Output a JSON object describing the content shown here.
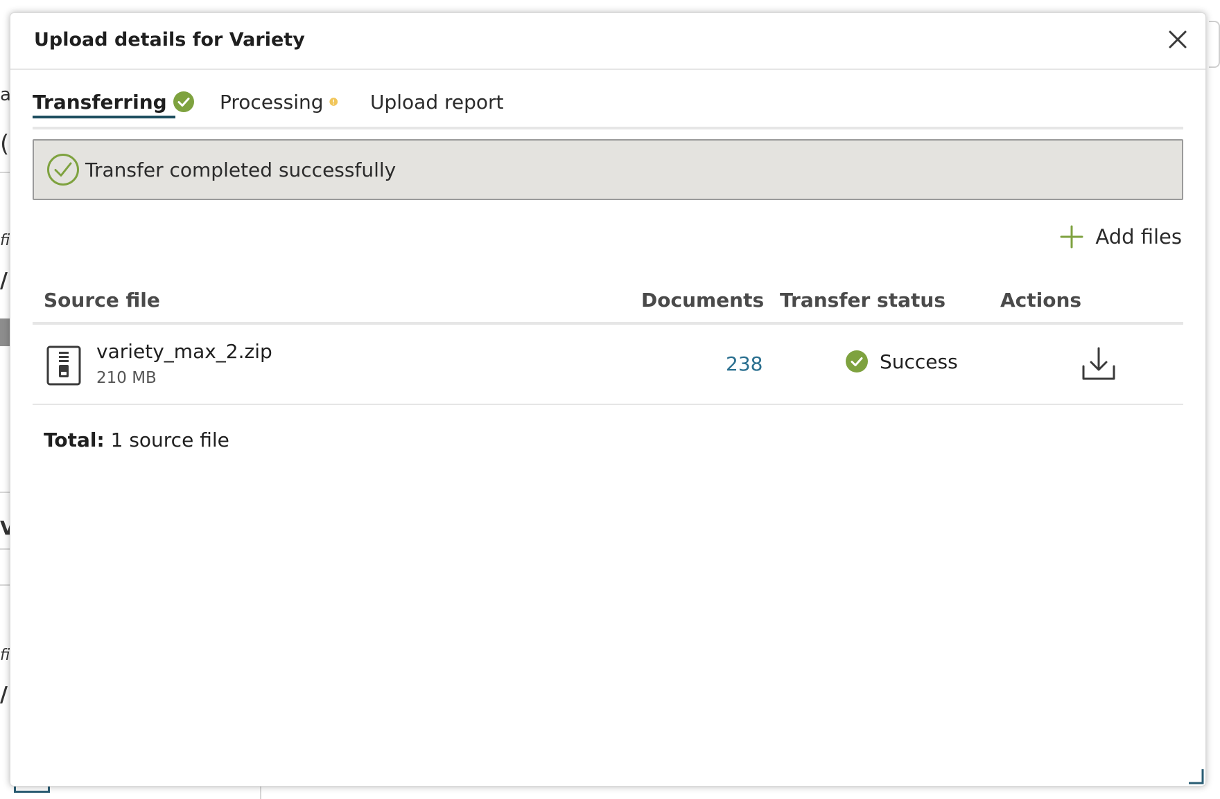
{
  "modal": {
    "title": "Upload details for Variety",
    "close_icon": "close-icon"
  },
  "tabs": [
    {
      "label": "Transferring",
      "icon": "check-circle-icon",
      "icon_color": "#7ea23f",
      "active": true
    },
    {
      "label": "Processing",
      "icon": "warning-circle-icon",
      "icon_color": "#f1c65a",
      "active": false
    },
    {
      "label": "Upload report",
      "active": false
    }
  ],
  "banner": {
    "text": "Transfer completed successfully",
    "icon": "check-circle-outline-icon",
    "icon_color": "#7ea23f"
  },
  "actions": {
    "add_files_label": "Add files",
    "add_icon": "plus-icon"
  },
  "table": {
    "headers": {
      "source_file": "Source file",
      "documents": "Documents",
      "transfer_status": "Transfer status",
      "actions": "Actions"
    },
    "rows": [
      {
        "file_name": "variety_max_2.zip",
        "file_size": "210 MB",
        "documents": "238",
        "status": "Success",
        "status_icon": "check-circle-icon",
        "action_icon": "download-icon"
      }
    ]
  },
  "footer": {
    "total_label": "Total:",
    "total_value": "1 source file"
  },
  "background": {
    "fragments": [
      "a",
      "(",
      "fi",
      "/",
      "Vi",
      "fi",
      "/"
    ]
  },
  "colors": {
    "accent": "#1d4e5f",
    "success": "#7ea23f",
    "warning": "#f1c65a",
    "link": "#2a6f8f"
  }
}
